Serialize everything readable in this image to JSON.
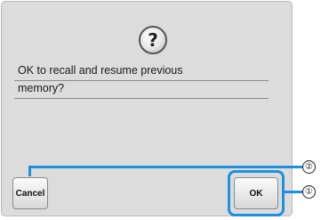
{
  "dialog": {
    "icon": "question-mark-icon",
    "icon_glyph": "?",
    "message_lines": [
      "OK to recall and resume previous",
      "memory?"
    ]
  },
  "buttons": {
    "cancel_label": "Cancel",
    "ok_label": "OK"
  },
  "callouts": {
    "ok_marker": "①",
    "cancel_marker": "②"
  },
  "colors": {
    "callout_accent": "#1e90e0",
    "dialog_background": "#dcdcdc"
  }
}
